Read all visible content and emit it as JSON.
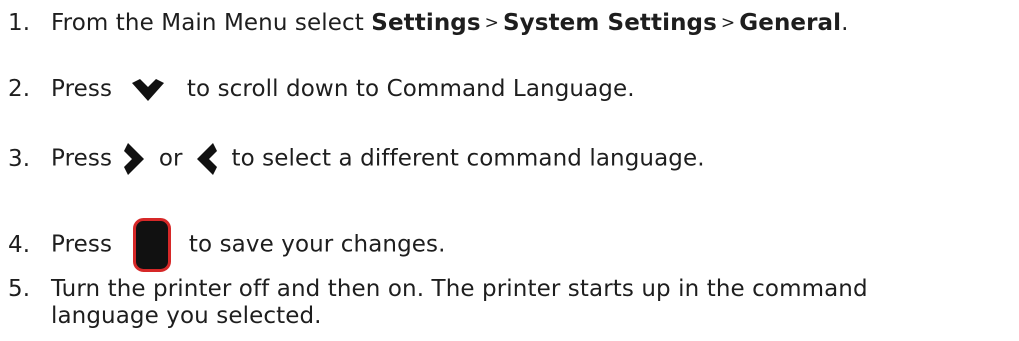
{
  "steps": [
    {
      "number": "1.",
      "text_a": "From the Main Menu select ",
      "bold_1": "Settings",
      "sep_1": ">",
      "bold_2": "System Settings",
      "sep_2": ">",
      "bold_3": "General",
      "text_end": "."
    },
    {
      "number": "2.",
      "text_a": "Press",
      "icon_1": "chevron-down-icon",
      "text_b": "to scroll down to Command Language."
    },
    {
      "number": "3.",
      "text_a": "Press",
      "icon_1": "chevron-right-icon",
      "text_b": "or",
      "icon_2": "chevron-left-icon",
      "text_c": "to select a different command language."
    },
    {
      "number": "4.",
      "text_a": "Press",
      "icon_1": "enter-key-icon",
      "text_b": "to save your changes."
    },
    {
      "number": "5.",
      "line_1": "Turn the printer off and then on. The printer starts up in the command",
      "line_2": "language you selected."
    }
  ],
  "colors": {
    "text": "#1e1e1e",
    "icon_fill": "#111111",
    "enter_key_border": "#d62828"
  }
}
